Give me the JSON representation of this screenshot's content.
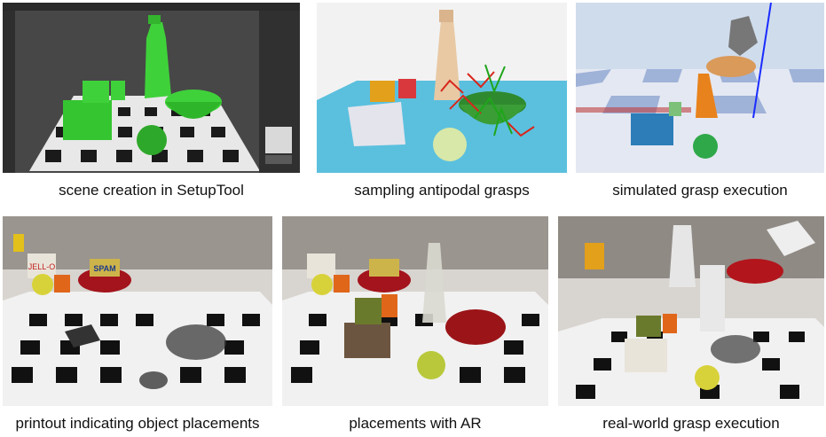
{
  "panels": [
    {
      "caption": "scene creation in SetupTool"
    },
    {
      "caption": "sampling antipodal grasps"
    },
    {
      "caption": "simulated grasp execution"
    },
    {
      "caption": "printout indicating object placements"
    },
    {
      "caption": "placements with AR"
    },
    {
      "caption": "real-world grasp execution"
    }
  ],
  "photo_text": {
    "spam": "SPAM",
    "jello": "JELL-O"
  },
  "colors": {
    "sim_green": "#3fd13a",
    "sim_sky": "#5bc0de",
    "grasp_red": "#d8261b",
    "grasp_green": "#1fa51a",
    "bowl_red": "#b3151c",
    "marker_black": "#111111"
  }
}
